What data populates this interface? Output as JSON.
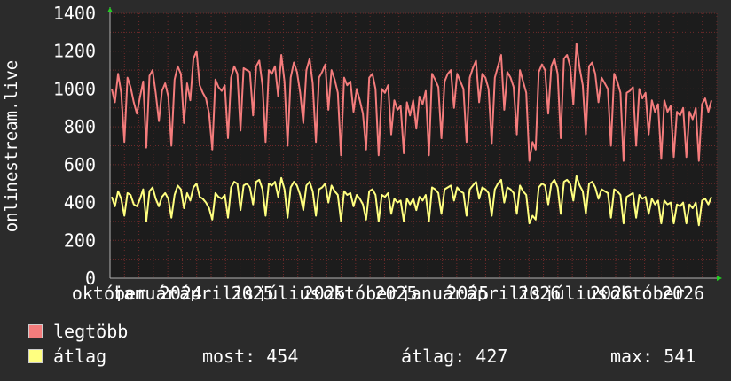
{
  "chart_data": {
    "type": "line",
    "ylabel": "onlinestream.live",
    "y_ticks": [
      "0",
      "200",
      "400",
      "600",
      "800",
      "1000",
      "1200",
      "1400"
    ],
    "ylim": [
      0,
      1400
    ],
    "x_tick_labels": [
      "október",
      "január",
      "2024",
      "április",
      "2025",
      "július",
      "2025",
      "október",
      "2025",
      "január",
      "2025",
      "április",
      "2026",
      "július",
      "2026",
      "október",
      "2026"
    ],
    "grid": true,
    "series": [
      {
        "name": "legtöbb",
        "color": "#f47c7c",
        "values": [
          1000,
          930,
          1080,
          980,
          720,
          1060,
          1010,
          930,
          870,
          960,
          1040,
          690,
          1070,
          1100,
          980,
          830,
          990,
          1030,
          960,
          700,
          1050,
          1120,
          1080,
          820,
          1030,
          940,
          1160,
          1200,
          1020,
          980,
          950,
          870,
          680,
          1050,
          1010,
          990,
          1020,
          740,
          1060,
          1120,
          1080,
          780,
          1110,
          1100,
          1090,
          860,
          1120,
          1150,
          1020,
          720,
          1100,
          1080,
          1120,
          960,
          1180,
          1040,
          700,
          1060,
          1140,
          1090,
          980,
          820,
          1100,
          1160,
          1030,
          720,
          1060,
          1090,
          1130,
          890,
          1100,
          1050,
          980,
          650,
          1060,
          1020,
          1040,
          880,
          1000,
          940,
          870,
          680,
          1060,
          1080,
          1000,
          650,
          1000,
          980,
          1020,
          760,
          940,
          890,
          910,
          660,
          930,
          860,
          940,
          790,
          960,
          920,
          990,
          650,
          1080,
          1050,
          1010,
          740,
          1040,
          1080,
          1100,
          900,
          1080,
          1040,
          1000,
          720,
          1060,
          1110,
          1150,
          930,
          1080,
          1060,
          1000,
          710,
          1060,
          1120,
          1180,
          890,
          1090,
          1060,
          1010,
          760,
          1100,
          1040,
          980,
          620,
          720,
          680,
          1090,
          1130,
          1100,
          870,
          1120,
          1160,
          1080,
          740,
          1160,
          1180,
          1120,
          920,
          1240,
          1110,
          1020,
          760,
          1120,
          1140,
          1080,
          930,
          1060,
          1030,
          1000,
          700,
          1080,
          1040,
          980,
          620,
          980,
          990,
          1010,
          700,
          1000,
          950,
          980,
          760,
          940,
          880,
          920,
          630,
          940,
          880,
          910,
          640,
          880,
          860,
          900,
          640,
          880,
          840,
          900,
          620,
          920,
          950,
          880,
          940
        ]
      },
      {
        "name": "átlag",
        "color": "#ffff80",
        "values": [
          430,
          380,
          460,
          420,
          330,
          450,
          440,
          390,
          380,
          420,
          470,
          300,
          460,
          480,
          420,
          380,
          430,
          450,
          420,
          320,
          440,
          490,
          470,
          370,
          450,
          410,
          480,
          500,
          430,
          420,
          400,
          370,
          310,
          450,
          430,
          420,
          440,
          320,
          480,
          510,
          500,
          360,
          490,
          500,
          480,
          390,
          510,
          520,
          470,
          330,
          500,
          490,
          510,
          430,
          530,
          470,
          320,
          480,
          510,
          490,
          440,
          360,
          490,
          510,
          460,
          330,
          470,
          480,
          500,
          400,
          490,
          460,
          440,
          300,
          460,
          440,
          450,
          380,
          440,
          420,
          390,
          310,
          460,
          470,
          440,
          300,
          440,
          430,
          450,
          340,
          420,
          400,
          410,
          300,
          420,
          390,
          420,
          360,
          430,
          410,
          440,
          300,
          480,
          470,
          450,
          340,
          470,
          480,
          490,
          410,
          480,
          460,
          450,
          330,
          470,
          490,
          510,
          420,
          480,
          470,
          450,
          330,
          470,
          500,
          520,
          400,
          480,
          470,
          450,
          340,
          490,
          460,
          440,
          290,
          330,
          310,
          480,
          500,
          490,
          390,
          500,
          520,
          480,
          340,
          510,
          520,
          500,
          410,
          540,
          490,
          460,
          340,
          500,
          510,
          480,
          420,
          470,
          460,
          450,
          320,
          470,
          460,
          440,
          290,
          430,
          440,
          450,
          320,
          440,
          420,
          430,
          340,
          420,
          390,
          410,
          290,
          410,
          390,
          400,
          290,
          390,
          380,
          400,
          290,
          390,
          370,
          400,
          280,
          410,
          420,
          390,
          430
        ]
      }
    ]
  },
  "legend": [
    {
      "label": "legtöbb",
      "color": "#f47c7c"
    },
    {
      "label": "átlag",
      "color": "#ffff80"
    }
  ],
  "stats": {
    "current": "most: 454",
    "average": "átlag: 427",
    "max": "max: 541"
  }
}
